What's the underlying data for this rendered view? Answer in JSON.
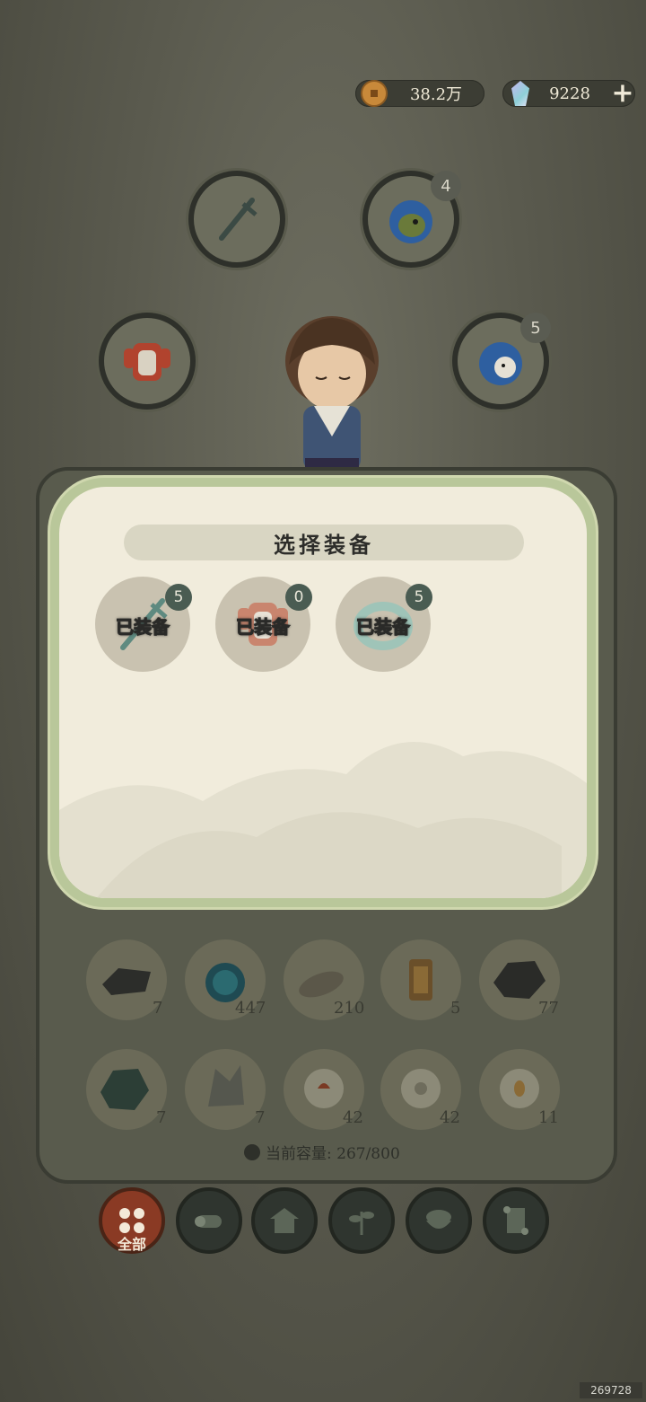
{
  "currency": {
    "coins": "38.2万",
    "coin_icon": "copper-coin-icon",
    "gems": "9228",
    "gem_icon": "crystal-icon",
    "add_label": "+"
  },
  "equipment_slots": [
    {
      "name": "weapon",
      "icon": "sword-icon",
      "badge": ""
    },
    {
      "name": "pet",
      "icon": "fish-spirit-icon",
      "badge": "4"
    },
    {
      "name": "armor",
      "icon": "armor-icon",
      "badge": ""
    },
    {
      "name": "spirit",
      "icon": "blue-spirit-icon",
      "badge": "5"
    }
  ],
  "modal": {
    "title": "选择装备",
    "options": [
      {
        "label": "已装备",
        "badge": "5",
        "icon": "sword-icon"
      },
      {
        "label": "已装备",
        "badge": "0",
        "icon": "armor-icon"
      },
      {
        "label": "已装备",
        "badge": "5",
        "icon": "jade-bracelet-icon"
      }
    ]
  },
  "inventory": {
    "items": [
      {
        "icon": "iron-ingot-icon",
        "count": "7"
      },
      {
        "icon": "spirit-orb-icon",
        "count": "447"
      },
      {
        "icon": "stone-icon",
        "count": "210"
      },
      {
        "icon": "gold-token-icon",
        "count": "5"
      },
      {
        "icon": "coal-icon",
        "count": "77"
      },
      {
        "icon": "green-ore-icon",
        "count": "7"
      },
      {
        "icon": "crystal-ore-icon",
        "count": "7"
      },
      {
        "icon": "rooster-egg-icon",
        "count": "42"
      },
      {
        "icon": "chick-egg-icon",
        "count": "42"
      },
      {
        "icon": "duck-egg-icon",
        "count": "11"
      }
    ],
    "capacity_label": "当前容量: 267/800"
  },
  "tabs": [
    {
      "label": "全部",
      "icon": "grid-icon",
      "active": true
    },
    {
      "label": "",
      "icon": "log-icon",
      "active": false
    },
    {
      "label": "",
      "icon": "house-icon",
      "active": false
    },
    {
      "label": "",
      "icon": "herb-icon",
      "active": false
    },
    {
      "label": "",
      "icon": "rice-bowl-icon",
      "active": false
    },
    {
      "label": "",
      "icon": "scroll-icon",
      "active": false
    }
  ],
  "watermark": "269728"
}
